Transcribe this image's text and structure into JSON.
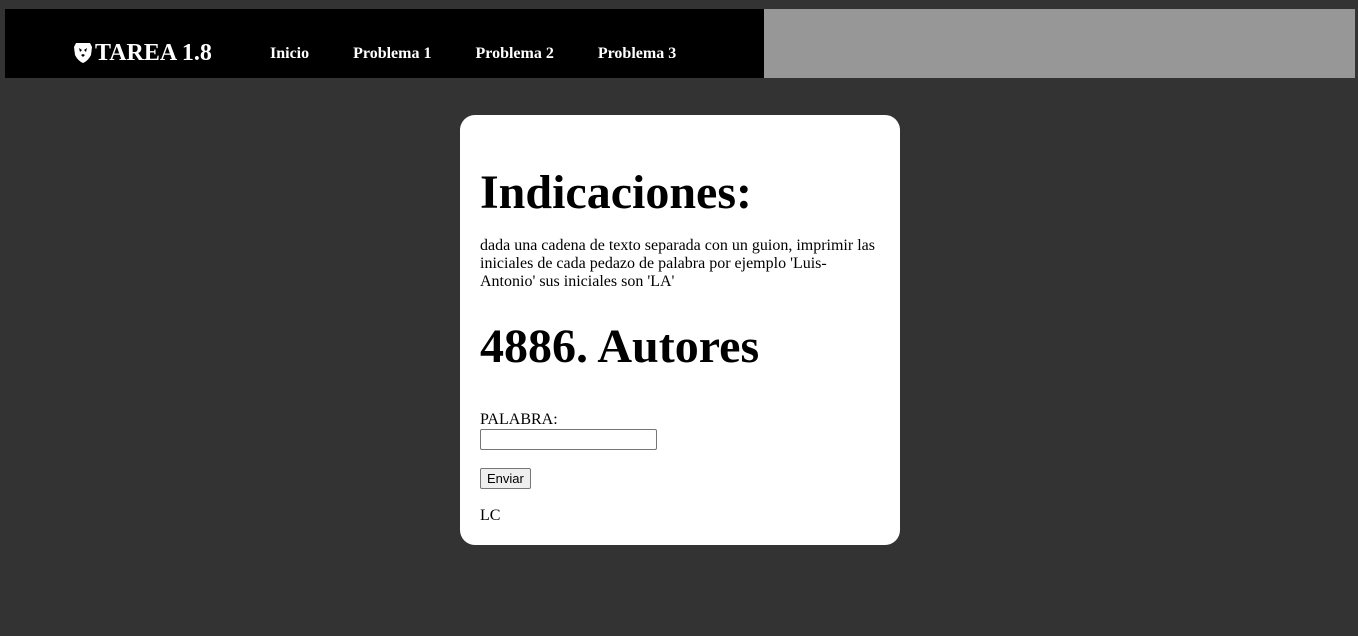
{
  "nav": {
    "brand": "TAREA 1.8",
    "links": [
      "Inicio",
      "Problema 1",
      "Problema 2",
      "Problema 3"
    ]
  },
  "card": {
    "heading": "Indicaciones:",
    "description": "dada una cadena de texto separada con un guion, imprimir las iniciales de cada pedazo de palabra por ejemplo 'Luis-Antonio' sus iniciales son 'LA'",
    "problem_title": "4886. Autores",
    "form": {
      "label": "PALABRA:",
      "input_value": "",
      "button_label": "Enviar"
    },
    "result": "LC"
  },
  "colors": {
    "page_bg": "#333333",
    "nav_bg": "#000000",
    "nav_right_bg": "#979797",
    "card_bg": "#ffffff"
  },
  "icons": {
    "brand_logo": "shield-lion-icon"
  }
}
